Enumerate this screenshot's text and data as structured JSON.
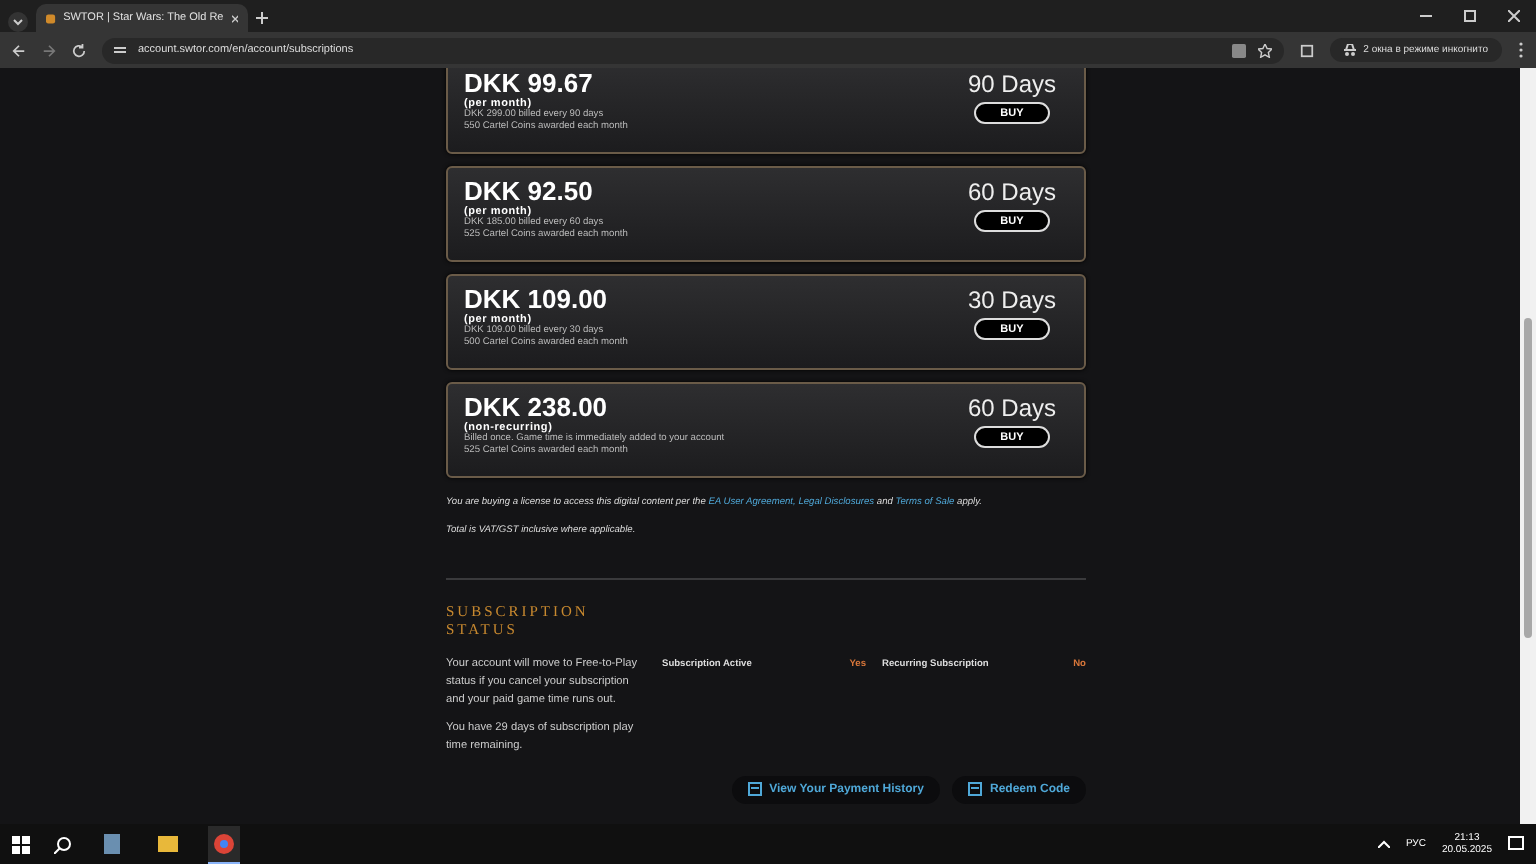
{
  "browser": {
    "tab_title": "SWTOR | Star Wars: The Old Re",
    "url": "account.swtor.com/en/account/subscriptions",
    "incognito_label": "2 окна в режиме инкогнито"
  },
  "plans": [
    {
      "price": "DKK 99.67",
      "period": "(per month)",
      "billing": "DKK 299.00 billed every 90 days",
      "coins": "550 Cartel Coins awarded each month",
      "duration": "90 Days",
      "button": "BUY"
    },
    {
      "price": "DKK 92.50",
      "period": "(per month)",
      "billing": "DKK 185.00 billed every 60 days",
      "coins": "525 Cartel Coins awarded each month",
      "duration": "60 Days",
      "button": "BUY"
    },
    {
      "price": "DKK 109.00",
      "period": "(per month)",
      "billing": "DKK 109.00 billed every 30 days",
      "coins": "500 Cartel Coins awarded each month",
      "duration": "30 Days",
      "button": "BUY"
    },
    {
      "price": "DKK 238.00",
      "period": "(non-recurring)",
      "billing": "Billed once. Game time is immediately added to your account",
      "coins": "525 Cartel Coins awarded each month",
      "duration": "60 Days",
      "button": "BUY"
    }
  ],
  "legal": {
    "before": "You are buying a license to access this digital content per the",
    "links": [
      "EA User Agreement",
      ", Legal Disclosures",
      "Terms of Sale"
    ],
    "joiner": "and",
    "after": "apply.",
    "vat": "Total is VAT/GST inclusive where applicable."
  },
  "status": {
    "heading": "SUBSCRIPTION STATUS",
    "note": "Your account will move to Free-to-Play status if you cancel your subscription and your paid game time runs out.",
    "remaining": "You have 29 days of subscription play time remaining.",
    "fields": [
      {
        "label": "Subscription Active",
        "value": "Yes"
      },
      {
        "label": "Recurring Subscription",
        "value": "No"
      }
    ],
    "buttons": [
      "View Your Payment History",
      "Redeem Code"
    ]
  },
  "taskbar": {
    "language": "РУС",
    "time": "21:13",
    "date": "20.05.2025"
  }
}
